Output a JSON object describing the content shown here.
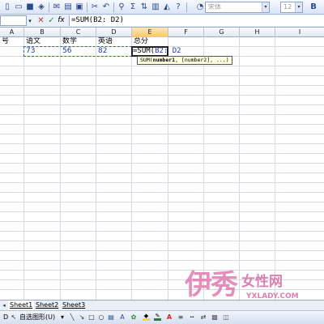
{
  "toolbar": {
    "font_name": "宋体",
    "font_size": "12",
    "icons": [
      "new-icon",
      "open-icon",
      "save-icon",
      "permission-icon",
      "email-icon",
      "print-icon",
      "print-preview-icon",
      "spelling-icon",
      "research-icon",
      "cut-icon",
      "copy-icon",
      "paste-icon",
      "format-painter-icon",
      "undo-icon",
      "redo-icon",
      "hyperlink-icon",
      "autosum-icon",
      "sort-icon",
      "chart-icon",
      "drawing-icon",
      "zoom-icon",
      "help-icon"
    ]
  },
  "formula_bar": {
    "name_box": "",
    "cancel_icon": "✕",
    "enter_icon": "✓",
    "function_icon": "fx",
    "formula": "=SUM(B2: D2)"
  },
  "columns": [
    "A",
    "B",
    "C",
    "D",
    "E",
    "F",
    "G",
    "H",
    "I"
  ],
  "active_column": "E",
  "grid": {
    "header_row": [
      "号",
      "语文",
      "数学",
      "英语",
      "总分"
    ],
    "data_row": [
      "",
      "73",
      "56",
      "82",
      ""
    ],
    "editing_cell": {
      "prefix": "=SUM(",
      "ref": "B2: D2",
      "suffix": ""
    },
    "tooltip": {
      "func": "SUM",
      "arg1": "number1",
      "rest": ", [number2], ...)"
    }
  },
  "sheets": {
    "nav": "◂",
    "tabs": [
      "Sheet1",
      "Sheet2",
      "Sheet3"
    ],
    "active": "Sheet1"
  },
  "drawing_toolbar": {
    "autoshapes_label": "自选图形(U)",
    "draw_label": "D",
    "colors": {
      "fill": "#f5d742",
      "line": "#2b7a2b",
      "font": "#d42020"
    }
  },
  "watermark": {
    "logo": "伊秀",
    "text": "女性网",
    "url": "YXLADY.COM"
  }
}
